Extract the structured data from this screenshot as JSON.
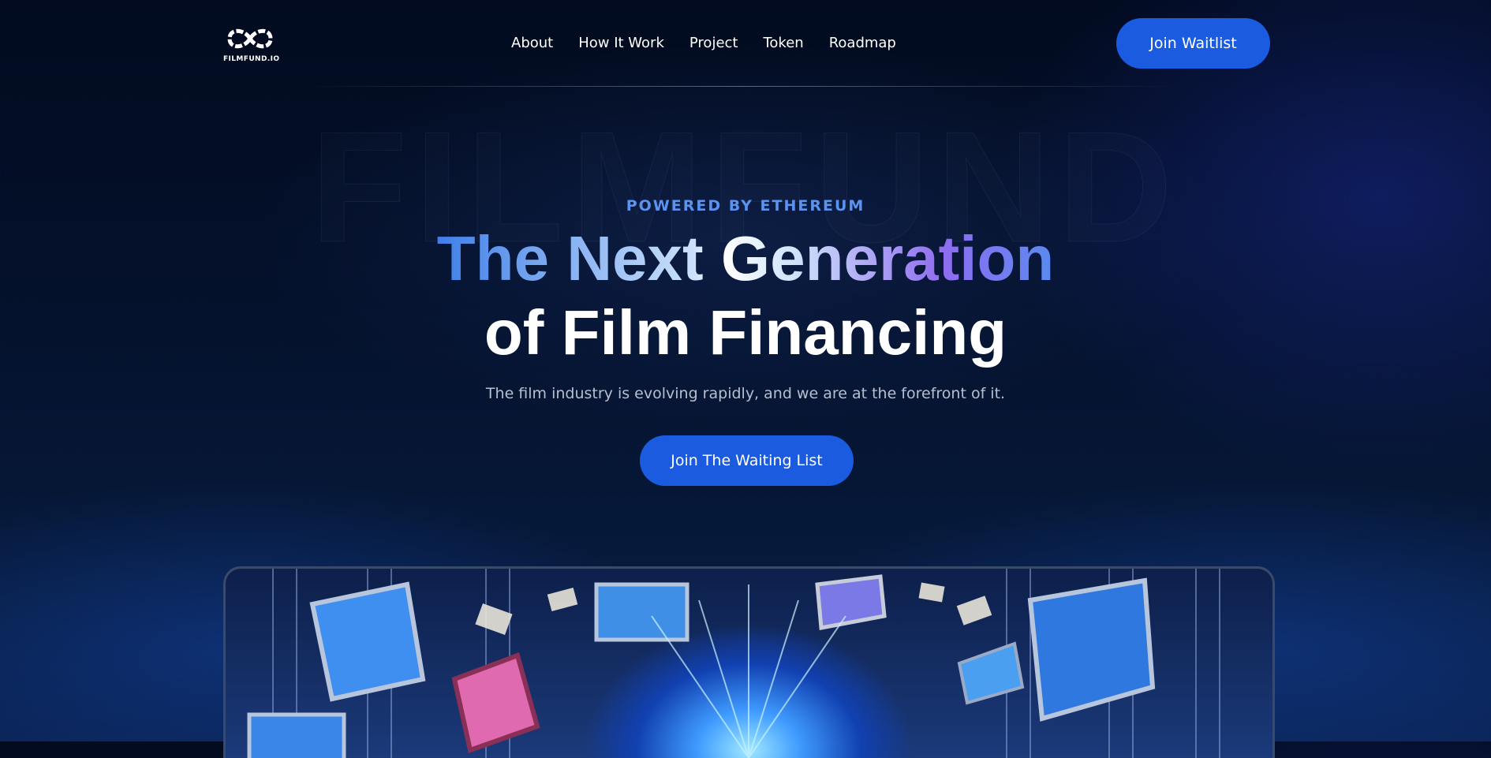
{
  "brand": {
    "logo_text": "FILMFUND.IO"
  },
  "nav": {
    "links": [
      "About",
      "How It Work",
      "Project",
      "Token",
      "Roadmap"
    ],
    "cta_label": "Join Waitlist"
  },
  "hero": {
    "watermark": "FILMFUND",
    "eyebrow": "POWERED BY ETHEREUM",
    "headline_line1": "The Next Generation",
    "headline_line2": "of Film Financing",
    "subtitle": "The film industry is evolving rapidly, and we are at the forefront of it.",
    "cta_label": "Join The Waiting List"
  },
  "colors": {
    "accent": "#1a5be0",
    "eyebrow": "#5b93f0",
    "background": "#04112b"
  },
  "icons": [
    "infinity-logo-icon"
  ],
  "media": {
    "showcase_image": "film-tech-collage-image"
  }
}
